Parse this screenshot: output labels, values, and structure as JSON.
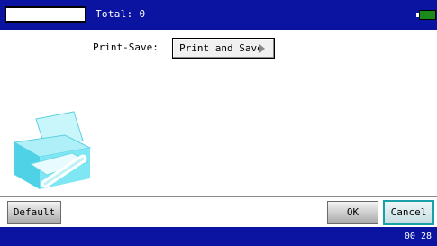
{
  "header": {
    "total_text": "Total: 0"
  },
  "settings": {
    "print_save_label": "Print-Save:",
    "print_save_value": "Print and Save"
  },
  "buttons": {
    "default": "Default",
    "ok": "OK",
    "cancel": "Cancel"
  },
  "status": {
    "clock": "00 28"
  },
  "colors": {
    "bar_blue": "#0a14a0",
    "accent_teal": "#1aa0a8",
    "battery_green": "#1a8a1a",
    "printer_cyan": "#7fe8f4"
  },
  "icons": {
    "printer": "printer-icon",
    "battery": "battery-icon",
    "dropdown_arrow": "chevron-right-icon"
  }
}
